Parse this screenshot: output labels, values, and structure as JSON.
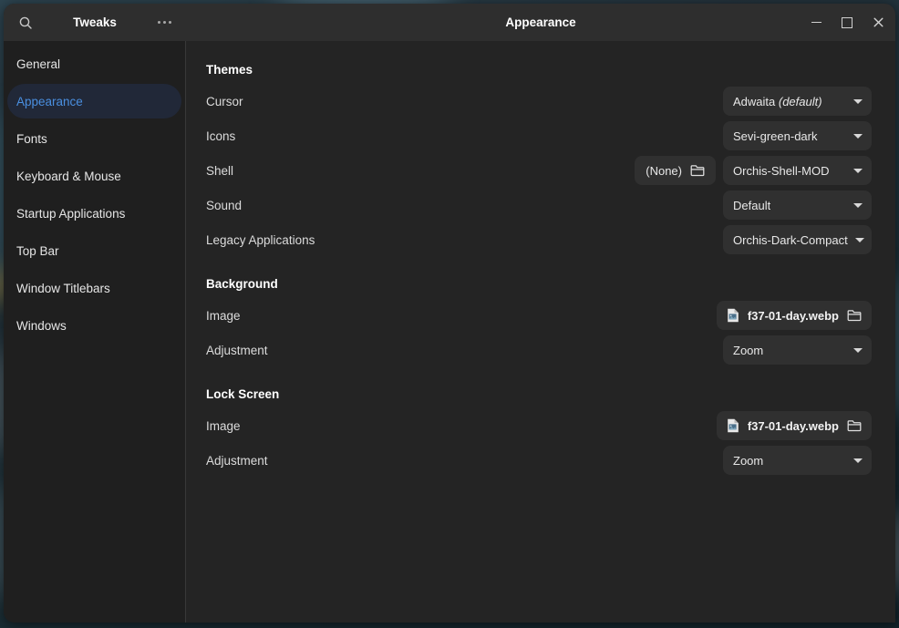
{
  "window": {
    "sidebar_title": "Tweaks",
    "page_title": "Appearance",
    "search_icon": "search-icon",
    "menu_icon": "hamburger-dots-icon",
    "controls": {
      "minimize": "minimize-icon",
      "maximize": "maximize-icon",
      "close": "close-icon"
    }
  },
  "sidebar": {
    "items": [
      {
        "label": "General",
        "selected": false
      },
      {
        "label": "Appearance",
        "selected": true
      },
      {
        "label": "Fonts",
        "selected": false
      },
      {
        "label": "Keyboard & Mouse",
        "selected": false
      },
      {
        "label": "Startup Applications",
        "selected": false
      },
      {
        "label": "Top Bar",
        "selected": false
      },
      {
        "label": "Window Titlebars",
        "selected": false
      },
      {
        "label": "Windows",
        "selected": false
      }
    ]
  },
  "content": {
    "themes": {
      "title": "Themes",
      "cursor": {
        "label": "Cursor",
        "value": "Adwaita",
        "value_suffix": " (default)"
      },
      "icons": {
        "label": "Icons",
        "value": "Sevi-green-dark"
      },
      "shell": {
        "label": "Shell",
        "picker_value": "(None)",
        "picker_icon": "folder-icon",
        "value": "Orchis-Shell-MOD"
      },
      "sound": {
        "label": "Sound",
        "value": "Default"
      },
      "legacy": {
        "label": "Legacy Applications",
        "value": "Orchis-Dark-Compact"
      }
    },
    "background": {
      "title": "Background",
      "image": {
        "label": "Image",
        "value": "f37-01-day.webp",
        "file_icon": "image-file-icon",
        "folder_icon": "folder-icon"
      },
      "adjustment": {
        "label": "Adjustment",
        "value": "Zoom"
      }
    },
    "lockscreen": {
      "title": "Lock Screen",
      "image": {
        "label": "Image",
        "value": "f37-01-day.webp",
        "file_icon": "image-file-icon",
        "folder_icon": "folder-icon"
      },
      "adjustment": {
        "label": "Adjustment",
        "value": "Zoom"
      }
    }
  },
  "colors": {
    "window_bg": "#242424",
    "headerbar_bg": "#2e2e2e",
    "sidebar_bg": "#1f1f1f",
    "control_bg": "#303030",
    "accent_text": "#4a8fe0",
    "selected_pill": "#212838"
  }
}
